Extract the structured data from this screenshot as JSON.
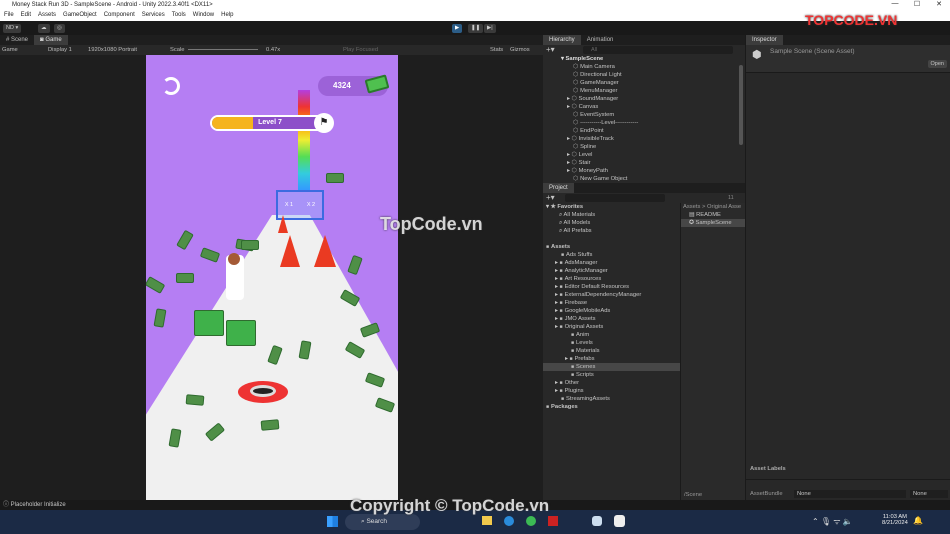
{
  "window": {
    "title": "Money Stack Run 3D - SampleScene - Android - Unity 2022.3.40f1 <DX11>",
    "controls": [
      "—",
      "☐",
      "✕"
    ]
  },
  "menu": [
    "File",
    "Edit",
    "Assets",
    "GameObject",
    "Component",
    "Services",
    "Tools",
    "Window",
    "Help"
  ],
  "toolbar": {
    "account": "ND ▾",
    "cloud": "☁",
    "collab": "◎",
    "play": "▶",
    "pause": "❚❚",
    "step": "▶|"
  },
  "scene_tabs": [
    {
      "label": "# Scene"
    },
    {
      "label": "◙ Game"
    }
  ],
  "game_toolbar": {
    "mode": "Game",
    "display": "Display 1",
    "resolution": "1920x1080 Portrait",
    "scale_label": "Scale",
    "scale_value": "0.47x",
    "play_focused": "Play Focused",
    "stats": "Stats",
    "gizmos": "Gizmos"
  },
  "game": {
    "coins": "4324",
    "level": "Level 7",
    "level_progress": 0.35,
    "gates": [
      "X 1",
      "X 2"
    ],
    "colors": {
      "background": "#b57ef3",
      "progress": "#f5b41e",
      "road": "#f0f0f0",
      "money": "#4f8f47"
    }
  },
  "hierarchy": {
    "tabs": [
      "Hierarchy",
      "Animation"
    ],
    "search_placeholder": "All",
    "scene": "SampleScene",
    "items": [
      {
        "label": "Main Camera",
        "expand": false
      },
      {
        "label": "Directional Light",
        "expand": false
      },
      {
        "label": "GameManager",
        "expand": false
      },
      {
        "label": "MenuManager",
        "expand": false
      },
      {
        "label": "SoundManager",
        "expand": true
      },
      {
        "label": "Canvas",
        "expand": true
      },
      {
        "label": "EventSystem",
        "expand": false
      },
      {
        "label": "-----------Level------------",
        "expand": false
      },
      {
        "label": "EndPoint",
        "expand": false
      },
      {
        "label": "InvisibleTrack",
        "expand": true
      },
      {
        "label": "Spline",
        "expand": false
      },
      {
        "label": "Level",
        "expand": true
      },
      {
        "label": "Stair",
        "expand": true
      },
      {
        "label": "MoneyPath",
        "expand": true
      },
      {
        "label": "New Game Object",
        "expand": false
      }
    ]
  },
  "project": {
    "tab": "Project",
    "hidden_count": "11",
    "favorites": "Favorites",
    "favorite_items": [
      "All Materials",
      "All Models",
      "All Prefabs"
    ],
    "assets": "Assets",
    "tree": [
      {
        "label": "Ads Stuffs",
        "depth": 1,
        "expand": false
      },
      {
        "label": "AdsManager",
        "depth": 1,
        "expand": true
      },
      {
        "label": "AnalyticManager",
        "depth": 1,
        "expand": true
      },
      {
        "label": "Art Resources",
        "depth": 1,
        "expand": true
      },
      {
        "label": "Editor Default Resources",
        "depth": 1,
        "expand": true
      },
      {
        "label": "ExternalDependencyManager",
        "depth": 1,
        "expand": true
      },
      {
        "label": "Firebase",
        "depth": 1,
        "expand": true
      },
      {
        "label": "GoogleMobileAds",
        "depth": 1,
        "expand": true
      },
      {
        "label": "JMO Assets",
        "depth": 1,
        "expand": true
      },
      {
        "label": "Original Assets",
        "depth": 1,
        "expand": true
      },
      {
        "label": "Anim",
        "depth": 2,
        "expand": false
      },
      {
        "label": "Levels",
        "depth": 2,
        "expand": false
      },
      {
        "label": "Materials",
        "depth": 2,
        "expand": false
      },
      {
        "label": "Prefabs",
        "depth": 2,
        "expand": true
      },
      {
        "label": "Scenes",
        "depth": 2,
        "expand": false,
        "selected": true
      },
      {
        "label": "Scripts",
        "depth": 2,
        "expand": false
      },
      {
        "label": "Other",
        "depth": 1,
        "expand": true
      },
      {
        "label": "Plugins",
        "depth": 1,
        "expand": true
      },
      {
        "label": "StreamingAssets",
        "depth": 1,
        "expand": false
      }
    ],
    "packages": "Packages",
    "breadcrumb": "Assets > Original Asse",
    "files": [
      "README",
      "SampleScene"
    ],
    "footer_path": "/Scene"
  },
  "inspector": {
    "tab": "Inspector",
    "title": "Sample Scene (Scene Asset)",
    "open": "Open",
    "asset_labels": "Asset Labels",
    "asset_bundle_label": "AssetBundle",
    "asset_bundle": "None",
    "variant": "None"
  },
  "status": {
    "message": "Placeholder Initialize"
  },
  "taskbar": {
    "search": "Search",
    "time": "11:03 AM",
    "date": "8/21/2024"
  },
  "watermarks": {
    "logo": "TOPCODE.VN",
    "center": "TopCode.vn",
    "footer": "Copyright © TopCode.vn"
  }
}
